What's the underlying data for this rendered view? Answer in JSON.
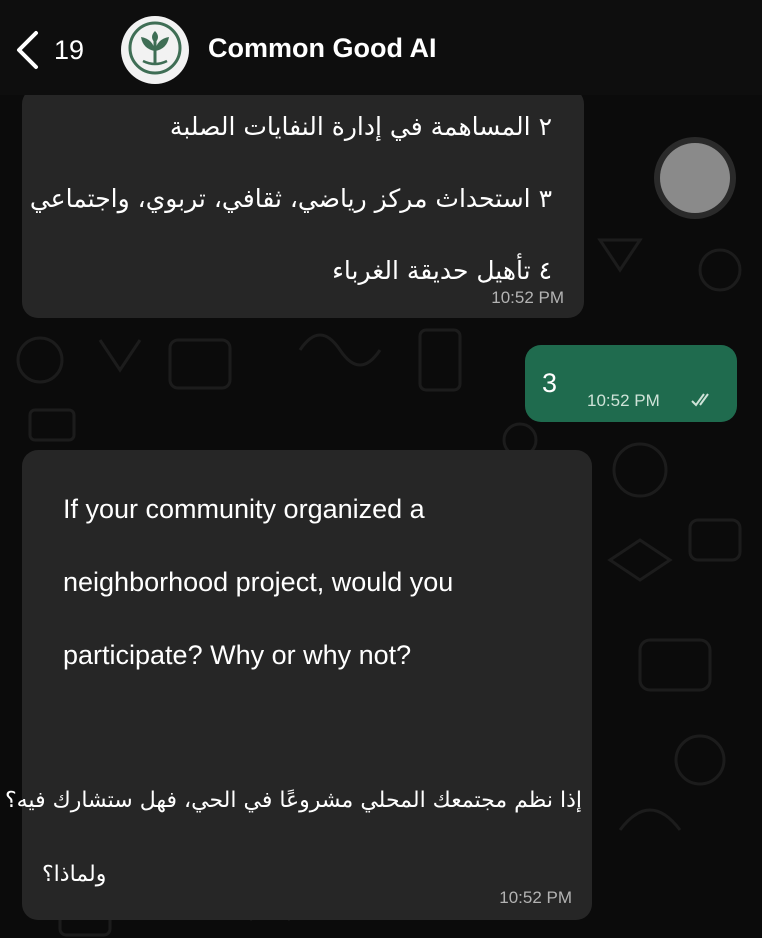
{
  "header": {
    "back_count": "19",
    "title": "Common Good AI"
  },
  "messages": [
    {
      "direction": "incoming",
      "lines": [
        "٢ المساهمة في إدارة النفايات الصلبة",
        "٣ استحداث مركز رياضي، ثقافي، تربوي، واجتماعي",
        "٤ تأهيل حديقة الغرباء"
      ],
      "time": "10:52 PM"
    },
    {
      "direction": "outgoing",
      "text": "3",
      "time": "10:52 PM",
      "status": "read"
    },
    {
      "direction": "incoming",
      "lines_en": [
        "If your community organized a",
        "neighborhood project, would you",
        "participate? Why or why not?"
      ],
      "lines_ar": [
        "إذا نظم مجتمعك المحلي مشروعًا في الحي، فهل ستشارك فيه؟",
        "ولماذا؟"
      ],
      "time": "10:52 PM"
    }
  ],
  "icons": {
    "back": "chevron-left-icon",
    "avatar": "leaf-logo-icon",
    "read_status": "double-check-icon"
  },
  "colors": {
    "background": "#0b0b0b",
    "incoming_bubble": "#262626",
    "outgoing_bubble": "#1f6b4e"
  }
}
